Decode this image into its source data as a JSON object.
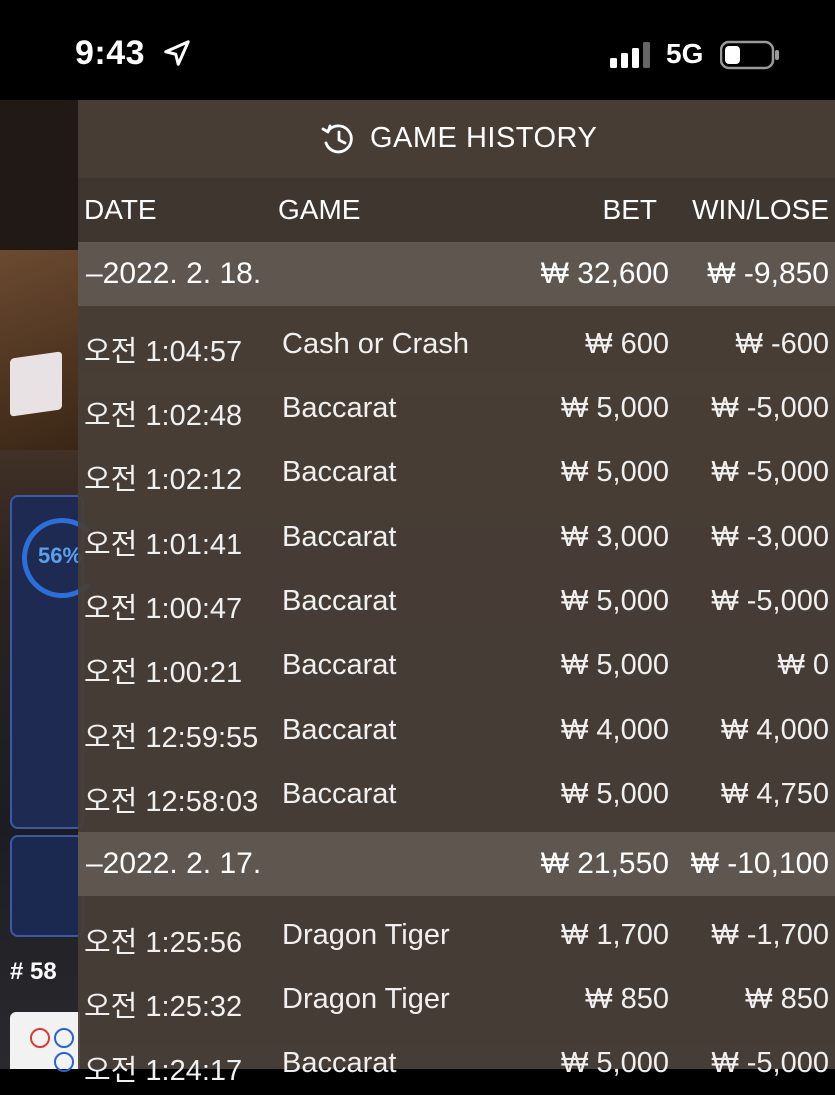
{
  "status_bar": {
    "time": "9:43",
    "network": "5G"
  },
  "background": {
    "progress_percent": "56%",
    "round_number": "# 58"
  },
  "panel": {
    "title": "GAME HISTORY",
    "columns": {
      "date": "DATE",
      "game": "GAME",
      "bet": "BET",
      "win_lose": "WIN/LOSE"
    }
  },
  "groups": [
    {
      "date": "–2022. 2. 18.",
      "bet_total": "₩ 32,600",
      "win_lose_total": "₩ -9,850",
      "rows": [
        {
          "time": "오전 1:04:57",
          "game": "Cash or Crash",
          "bet": "₩ 600",
          "win_lose": "₩ -600"
        },
        {
          "time": "오전 1:02:48",
          "game": "Baccarat",
          "bet": "₩ 5,000",
          "win_lose": "₩ -5,000"
        },
        {
          "time": "오전 1:02:12",
          "game": "Baccarat",
          "bet": "₩ 5,000",
          "win_lose": "₩ -5,000"
        },
        {
          "time": "오전 1:01:41",
          "game": "Baccarat",
          "bet": "₩ 3,000",
          "win_lose": "₩ -3,000"
        },
        {
          "time": "오전 1:00:47",
          "game": "Baccarat",
          "bet": "₩ 5,000",
          "win_lose": "₩ -5,000"
        },
        {
          "time": "오전 1:00:21",
          "game": "Baccarat",
          "bet": "₩ 5,000",
          "win_lose": "₩ 0"
        },
        {
          "time": "오전 12:59:55",
          "game": "Baccarat",
          "bet": "₩ 4,000",
          "win_lose": "₩ 4,000"
        },
        {
          "time": "오전 12:58:03",
          "game": "Baccarat",
          "bet": "₩ 5,000",
          "win_lose": "₩ 4,750"
        }
      ]
    },
    {
      "date": "–2022. 2. 17.",
      "bet_total": "₩ 21,550",
      "win_lose_total": "₩ -10,100",
      "rows": [
        {
          "time": "오전 1:25:56",
          "game": "Dragon Tiger",
          "bet": "₩ 1,700",
          "win_lose": "₩ -1,700"
        },
        {
          "time": "오전 1:25:32",
          "game": "Dragon Tiger",
          "bet": "₩ 850",
          "win_lose": "₩ 850"
        },
        {
          "time": "오전 1:24:17",
          "game": "Baccarat",
          "bet": "₩ 5,000",
          "win_lose": "₩ -5,000"
        }
      ]
    }
  ]
}
